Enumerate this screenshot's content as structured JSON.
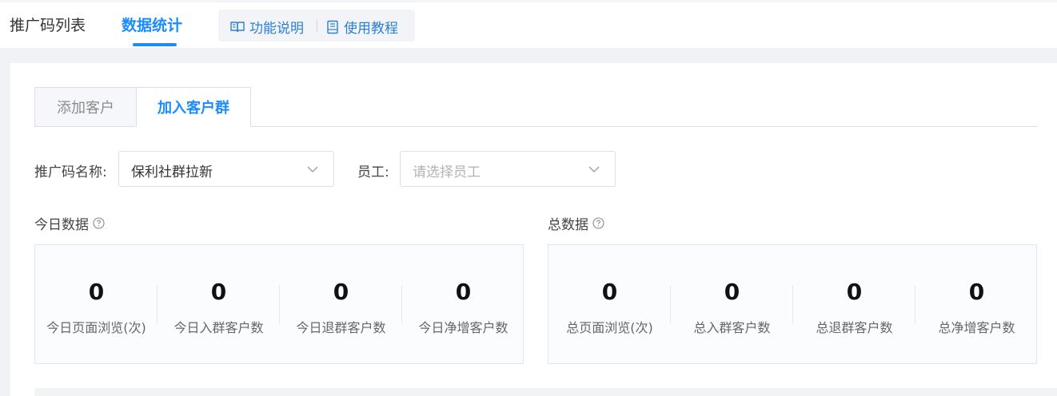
{
  "top_tabs": [
    {
      "label": "推广码列表",
      "active": false
    },
    {
      "label": "数据统计",
      "active": true
    }
  ],
  "help_links": {
    "feature_desc": "功能说明",
    "tutorial": "使用教程"
  },
  "sub_tabs": [
    {
      "label": "添加客户",
      "active": false
    },
    {
      "label": "加入客户群",
      "active": true
    }
  ],
  "filters": {
    "code_name_label": "推广码名称:",
    "code_name_value": "保利社群拉新",
    "employee_label": "员工:",
    "employee_placeholder": "请选择员工"
  },
  "today": {
    "title": "今日数据",
    "stats": [
      {
        "value": "0",
        "label": "今日页面浏览(次)"
      },
      {
        "value": "0",
        "label": "今日入群客户数"
      },
      {
        "value": "0",
        "label": "今日退群客户数"
      },
      {
        "value": "0",
        "label": "今日净增客户数"
      }
    ]
  },
  "total": {
    "title": "总数据",
    "stats": [
      {
        "value": "0",
        "label": "总页面浏览(次)"
      },
      {
        "value": "0",
        "label": "总入群客户数"
      },
      {
        "value": "0",
        "label": "总退群客户数"
      },
      {
        "value": "0",
        "label": "总净增客户数"
      }
    ]
  },
  "colors": {
    "accent": "#1a8cff",
    "link": "#2c7fd6",
    "panel_border": "#dbe7f3"
  }
}
